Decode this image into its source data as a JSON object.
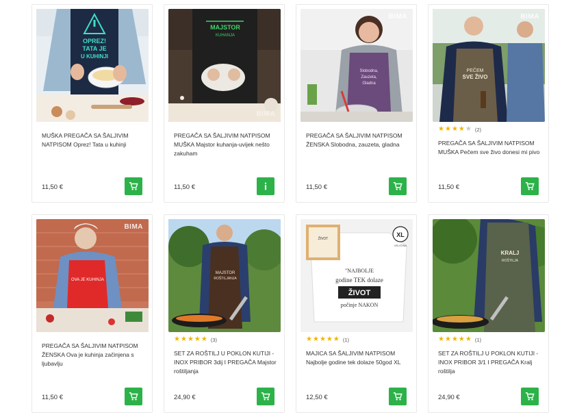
{
  "colors": {
    "accent": "#2db24a",
    "star": "#f0b400",
    "star_empty": "#c8c8c8"
  },
  "products": [
    {
      "id": "p1",
      "title": "MUŠKA PREGAČA SA ŠALJIVIM NATPISOM Oprez! Tata u kuhinji",
      "price": "11,50 €",
      "action_icon": "cart-icon",
      "stars": 0,
      "reviews": "",
      "image_text": "OPREZ! TATA JE U KUHINJI",
      "watermark": ""
    },
    {
      "id": "p2",
      "title": "PREGAČA SA ŠALJIVIM NATPISOM MUŠKA Majstor kuhanja-uvijek nešto zakuham",
      "price": "11,50 €",
      "action_icon": "info-icon",
      "stars": 0,
      "reviews": "",
      "image_text": "MAJSTOR KUHANJA",
      "watermark": "BIMA"
    },
    {
      "id": "p3",
      "title": "PREGAČA SA ŠALJIVIM NATPISOM ŽENSKA Slobodna, zauzeta, gladna",
      "price": "11,50 €",
      "action_icon": "cart-icon",
      "stars": 0,
      "reviews": "",
      "image_text": "Slobodna, Zauzeta, Gladna",
      "watermark": "BIMA"
    },
    {
      "id": "p4",
      "title": "PREGAČA SA ŠALJIVIM NATPISOM MUŠKA Pečem sve živo donesi mi pivo",
      "price": "11,50 €",
      "action_icon": "cart-icon",
      "stars": 4,
      "reviews": "(2)",
      "image_text": "PEČEM SVE ŽIVO",
      "watermark": "BIMA"
    },
    {
      "id": "p5",
      "title": "PREGAČA SA ŠALJIVIM NATPISOM ŽENSKA Ova je kuhinja začinjena s ljubavlju",
      "price": "11,50 €",
      "action_icon": "cart-icon",
      "stars": 0,
      "reviews": "",
      "image_text": "OVA JE KUHINJA",
      "watermark": "BIMA"
    },
    {
      "id": "p6",
      "title": "SET ZA ROŠTILJ U POKLON KUTIJI - INOX PRIBOR 3dij I PREGAČA Majstor roštiljanja",
      "price": "24,90 €",
      "action_icon": "cart-icon",
      "stars": 5,
      "reviews": "(3)",
      "image_text": "MAJSTOR ROŠTILJANJA",
      "watermark": ""
    },
    {
      "id": "p7",
      "title": "MAJICA SA ŠALJIVIM NATPISOM Najbolje godine tek dolaze 50god XL",
      "price": "12,50 €",
      "action_icon": "cart-icon",
      "stars": 5,
      "reviews": "(1)",
      "image_text": "NAJBOLJE godine TEK dolaze ŽIVOT počinje NAKON",
      "watermark": "",
      "size_badge": "XL",
      "size_label": "VELIČINA"
    },
    {
      "id": "p8",
      "title": "SET ZA ROŠTILJ U POKLON KUTIJI - INOX PRIBOR 3/1 I PREGAČA Kralj roštilja",
      "price": "24,90 €",
      "action_icon": "cart-icon",
      "stars": 5,
      "reviews": "(1)",
      "image_text": "KRALJ ROŠTILJA",
      "watermark": ""
    }
  ]
}
